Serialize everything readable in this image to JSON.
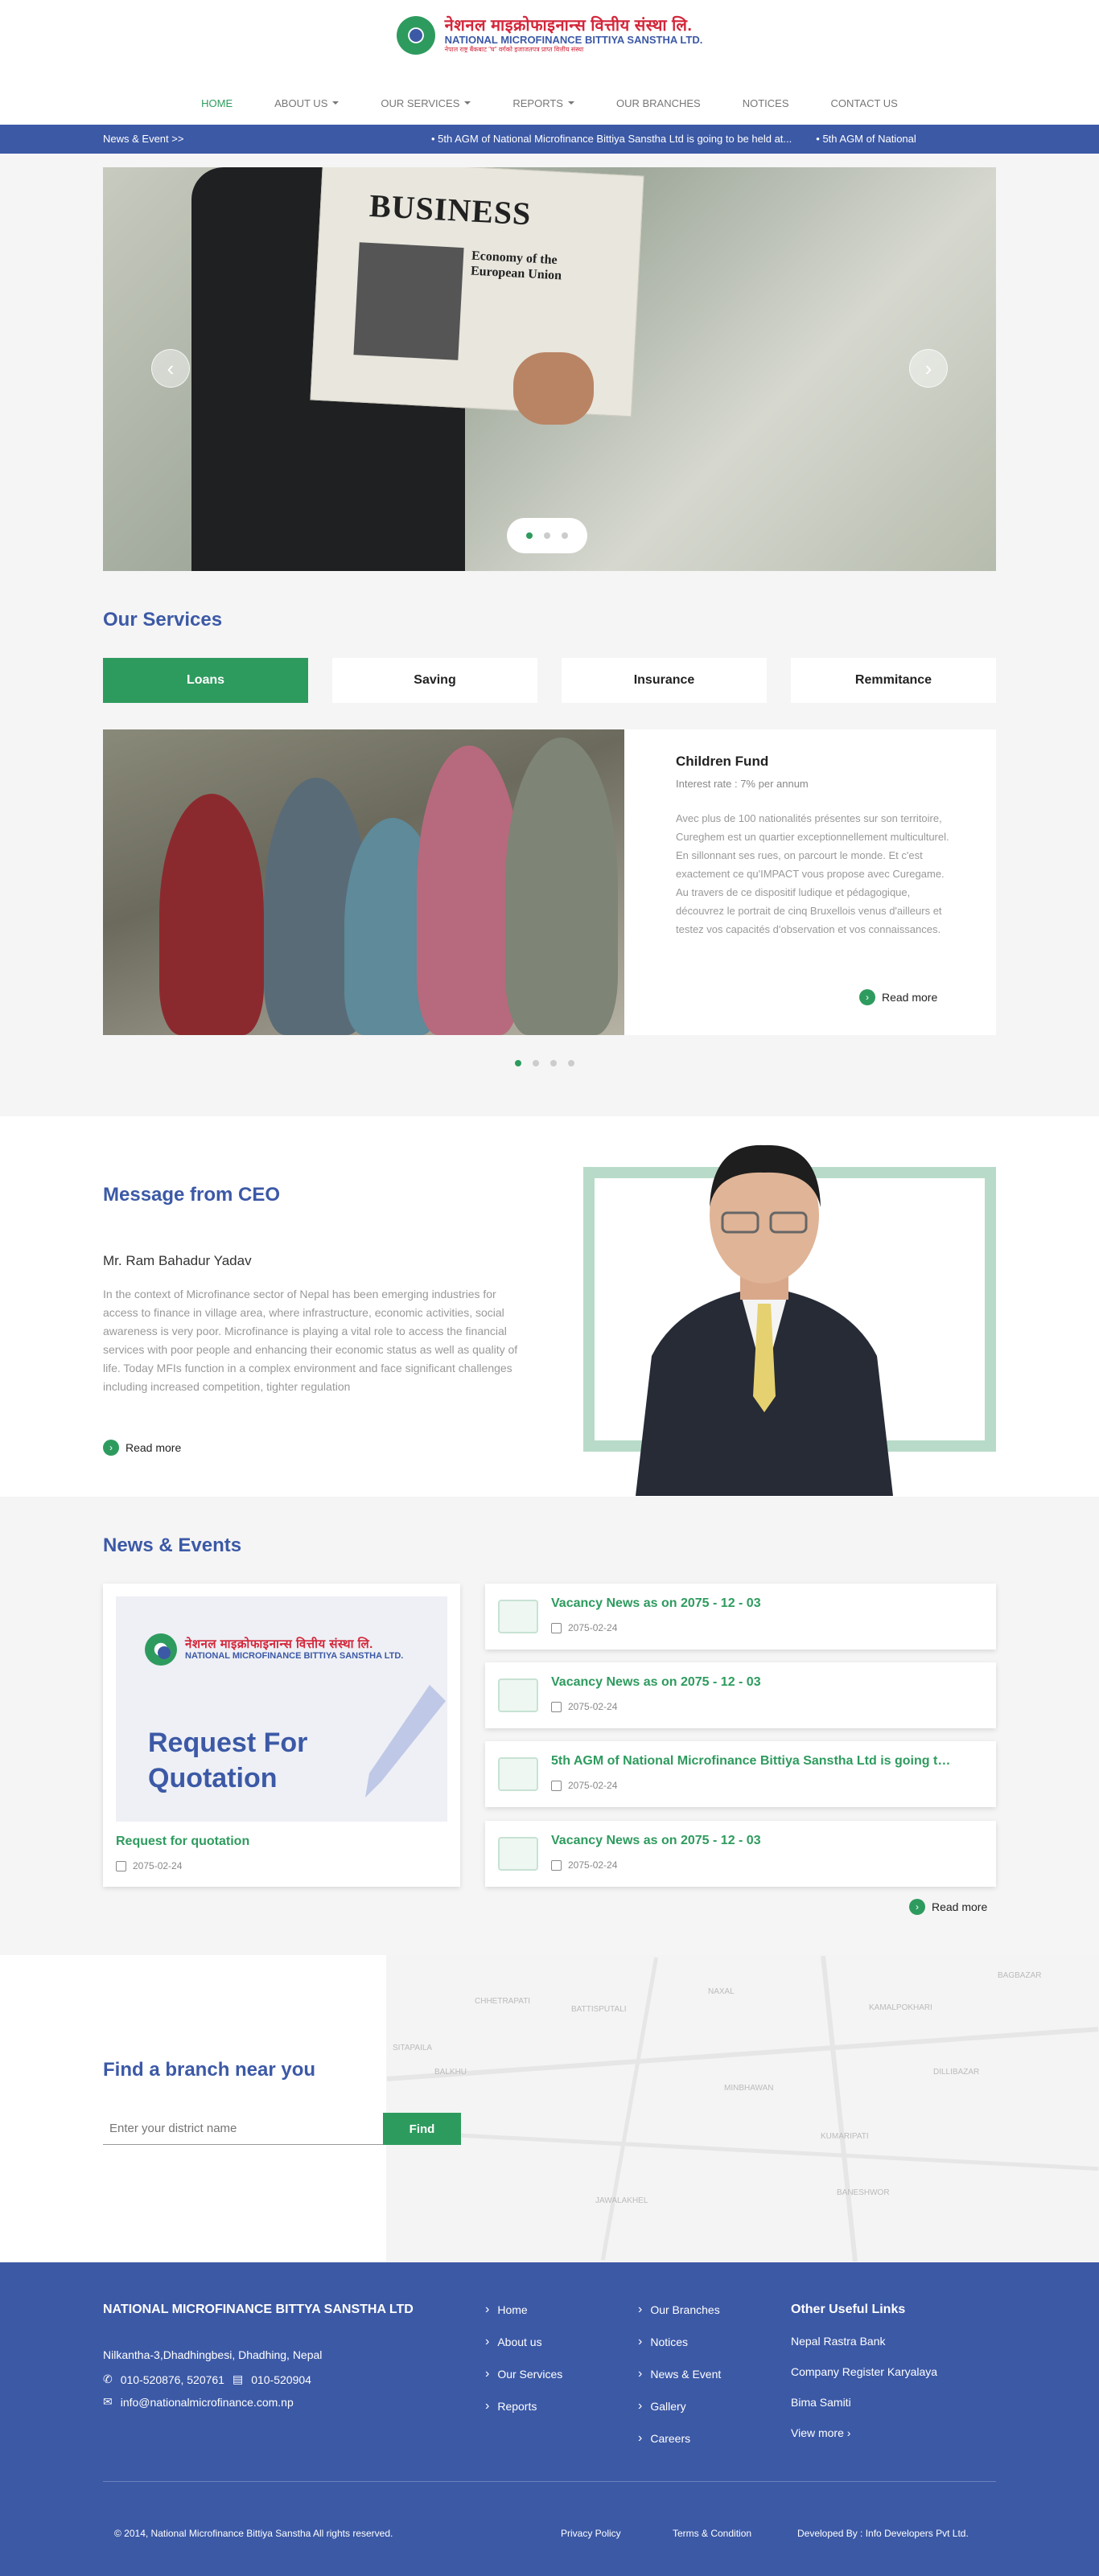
{
  "brand": {
    "name_np": "नेशनल माइक्रोफाइनान्स वित्तीय संस्था लि.",
    "name_en": "NATIONAL MICROFINANCE BITTIYA SANSTHA LTD.",
    "tagline": "नेपाल राष्ट्र बैंकबाट \"घ\" वर्गको इजाजतपत्र प्राप्त वित्तीय संस्था"
  },
  "nav": [
    {
      "label": "HOME"
    },
    {
      "label": "ABOUT US"
    },
    {
      "label": "OUR SERVICES"
    },
    {
      "label": "REPORTS"
    },
    {
      "label": "OUR BRANCHES"
    },
    {
      "label": "NOTICES"
    },
    {
      "label": "CONTACT US"
    }
  ],
  "ticker": {
    "label": "News & Event >>",
    "items": [
      "5th AGM of National Microfinance Bittiya Sanstha Ltd is going to be held at...",
      "5th AGM of National"
    ]
  },
  "hero": {
    "paper_title": "BUSINESS",
    "paper_sub": "Economy of the European Union",
    "prev": "‹",
    "next": "›"
  },
  "services": {
    "heading": "Our Services",
    "tabs": [
      "Loans",
      "Saving",
      "Insurance",
      "Remmitance"
    ],
    "card": {
      "title": "Children Fund",
      "rate": "Interest rate : 7% per annum",
      "desc": "Avec plus de 100 nationalités présentes sur son territoire, Cureghem est un quartier exceptionnellement multiculturel. En sillonnant ses rues, on parcourt le monde. Et c'est exactement ce qu'IMPACT vous propose avec Curegame. Au travers de ce dispositif ludique et pédagogique, découvrez le portrait de cinq Bruxellois venus d'ailleurs et testez vos capacités d'observation et vos connaissances.",
      "more": "Read more"
    }
  },
  "ceo": {
    "heading": "Message from CEO",
    "name": "Mr. Ram Bahadur Yadav",
    "message": "In the context of Microfinance sector of Nepal has been emerging industries for access to finance in village area, where infrastructure, economic activities, social awareness is very poor. Microfinance is playing a vital role to access the financial services with poor people and enhancing their economic status as well as quality of life. Today MFIs function in a complex environment and face significant challenges including increased competition, tighter regulation",
    "more": "Read more"
  },
  "news": {
    "heading": "News & Events",
    "main": {
      "image_heading": "Request For Quotation",
      "title": "Request for quotation",
      "date": "2075-02-24"
    },
    "items": [
      {
        "title": "Vacancy News as on 2075 - 12 - 03",
        "date": "2075-02-24"
      },
      {
        "title": "Vacancy News as on 2075 - 12 - 03",
        "date": "2075-02-24"
      },
      {
        "title": "5th AGM of National Microfinance Bittiya Sanstha Ltd is going to be held at...",
        "date": "2075-02-24"
      },
      {
        "title": "Vacancy News as on 2075 - 12 - 03",
        "date": "2075-02-24"
      }
    ],
    "more": "Read more"
  },
  "branch": {
    "heading": "Find a branch near you",
    "placeholder": "Enter your district name",
    "button": "Find",
    "map_labels": [
      "CHHETRAPATI",
      "BATTISPUTALI",
      "NAXAL",
      "KAMALPOKHARI",
      "BAGBAZAR",
      "DILLIBAZAR",
      "BALKHU",
      "MINBHAWAN",
      "KUMARIPATI",
      "SITAPAILA",
      "BANESHWOR",
      "JAWALAKHEL"
    ]
  },
  "footer": {
    "company": "NATIONAL MICROFINANCE BITTYA SANSTHA LTD",
    "address": "Nilkantha-3,Dhadhingbesi, Dhadhing, Nepal",
    "phone": "010-520876, 520761",
    "fax": "010-520904",
    "email": "info@nationalmicrofinance.com.np",
    "col1": [
      "Home",
      "About us",
      "Our Services",
      "Reports"
    ],
    "col2": [
      "Our Branches",
      "Notices",
      "News & Event",
      "Gallery",
      "Careers"
    ],
    "useful_heading": "Other Useful Links",
    "useful": [
      "Nepal Rastra Bank",
      "Company Register Karyalaya",
      "Bima Samiti",
      "View more  ›"
    ],
    "copyright": "©  2014, National Microfinance Bittiya Sanstha All rights reserved.",
    "privacy": "Privacy Policy",
    "terms": "Terms & Condition",
    "developed": "Developed By : Info Developers Pvt Ltd."
  },
  "colors": {
    "primary": "#3c59a6",
    "accent": "#2e9b5e",
    "brand_red": "#d3263a"
  }
}
